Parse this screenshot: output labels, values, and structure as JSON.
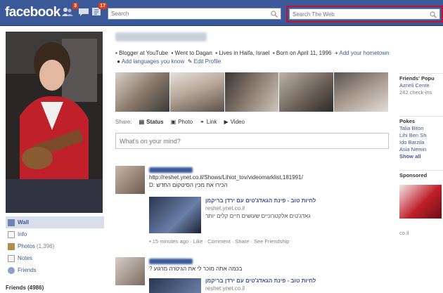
{
  "topbar": {
    "logo": "facebook",
    "friend_requests_count": "3",
    "notifications_count": "17",
    "search_placeholder": "Search",
    "web_search_placeholder": "Search The Web"
  },
  "profile": {
    "info": {
      "work": "Blogger at YouTube",
      "education": "Went to Dagan",
      "lives": "Lives in Haifa, Israel",
      "born": "Born on April 11, 1996",
      "add_hometown": "Add your hometown",
      "add_languages": "Add languages you know",
      "edit_profile": "Edit Profile"
    }
  },
  "left_nav": {
    "items": [
      {
        "label": "Wall",
        "count": ""
      },
      {
        "label": "Info",
        "count": ""
      },
      {
        "label": "Photos",
        "count": "(1,396)"
      },
      {
        "label": "Notes",
        "count": ""
      },
      {
        "label": "Friends",
        "count": ""
      }
    ],
    "friends_header": "Friends (4986)"
  },
  "share": {
    "label": "Share:",
    "options": [
      "Status",
      "Photo",
      "Link",
      "Video"
    ],
    "composer_placeholder": "What's on your mind?"
  },
  "posts": [
    {
      "url": "http://reshet.ynet.co.il/Shows/Lihiot_tov/videomarklist,181991/",
      "text": "הכירו את מכין הסיטקום החדש :D",
      "attachment_title": "לחיות טוב - פינת הגאדג'טים עם ירדן בריקמן",
      "attachment_domain": "reshet.ynet.co.il",
      "attachment_desc": "גאדג'טים אלקטרוניים שעושים חיים קלים יותר",
      "meta": "15 minutes ago · Like · Comment · Share · See Friendship"
    },
    {
      "text": "בכמה אתה מוכר לי את הגיטרה מרגוע ?",
      "attachment_title": "לחיות טוב - פינת הגאדג'טים עם ירדן בריקמן",
      "attachment_domain": "reshet.ynet.co.il"
    }
  ],
  "right_col": {
    "popular_header": "Friends' Popu",
    "place_name": "Azrieli Cente",
    "place_checkins": "242 check-ins",
    "pokes_header": "Pokes",
    "pokes": [
      "Talia Biton",
      "Lihi Ben Sh",
      "Ido Barzila",
      "Asia Nemin"
    ],
    "show_all": "Show all",
    "sponsored_header": "Sponsored",
    "sponsored_domain": "co.il"
  },
  "colors": {
    "brand": "#3b5998",
    "badge": "#dd3c10",
    "highlight_border": "#c8102e"
  }
}
